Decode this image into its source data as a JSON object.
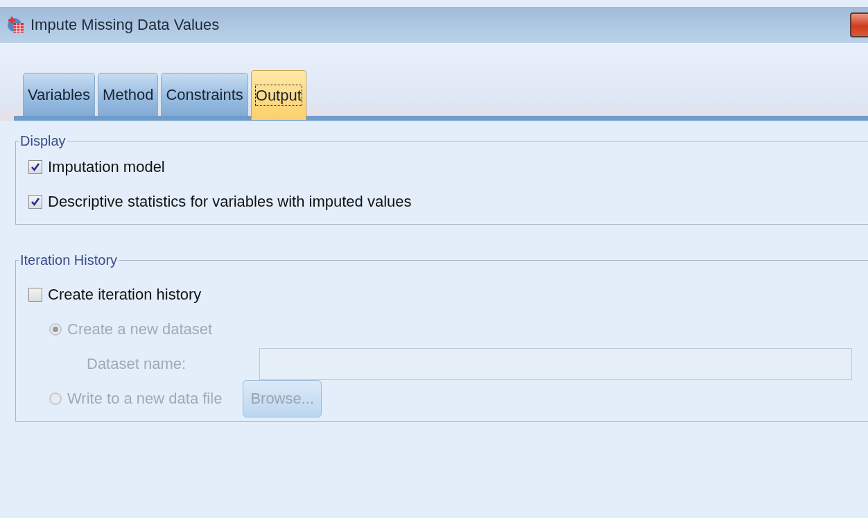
{
  "window": {
    "title": "Impute Missing Data Values"
  },
  "tabs": [
    {
      "label": "Variables",
      "selected": false
    },
    {
      "label": "Method",
      "selected": false
    },
    {
      "label": "Constraints",
      "selected": false
    },
    {
      "label": "Output",
      "selected": true
    }
  ],
  "display": {
    "title": "Display",
    "options": [
      {
        "label": "Imputation model",
        "checked": true
      },
      {
        "label": "Descriptive statistics for variables with imputed values",
        "checked": true
      }
    ]
  },
  "iteration_history": {
    "title": "Iteration History",
    "create": {
      "label": "Create iteration history",
      "checked": false
    },
    "destinations": [
      {
        "label": "Create a new dataset",
        "selected": true,
        "disabled": true
      },
      {
        "label": "Write to a new data file",
        "selected": false,
        "disabled": true
      }
    ],
    "dataset_name": {
      "label": "Dataset name:",
      "disabled": true
    },
    "browse_button": {
      "label": "Browse...",
      "disabled": true
    }
  }
}
